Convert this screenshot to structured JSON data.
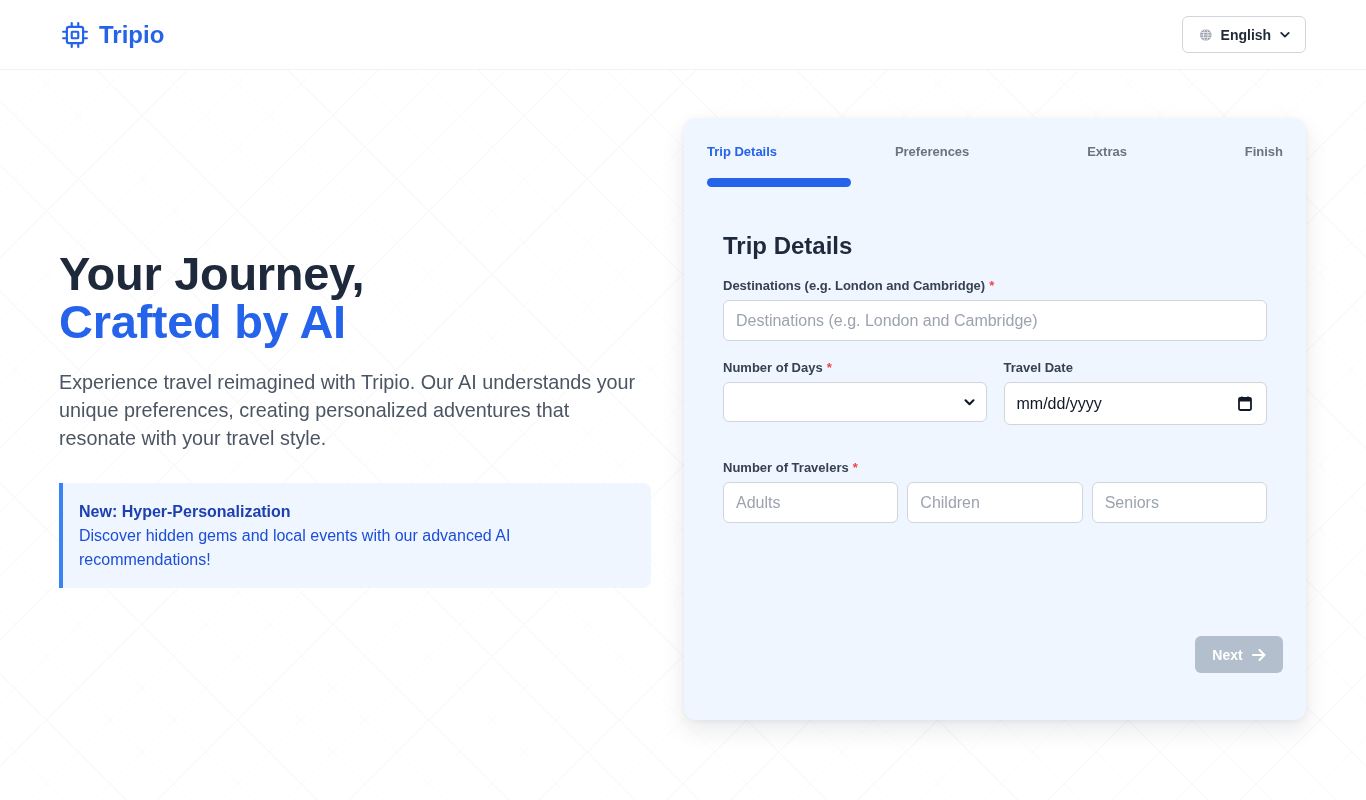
{
  "header": {
    "logo": {
      "text": "Tripio"
    },
    "language_button": {
      "label": "English"
    }
  },
  "hero": {
    "title_line_1": "Your Journey,",
    "title_line_2": "Crafted by AI",
    "description": "Experience travel reimagined with Tripio. Our AI understands your unique preferences, creating personalized adventures that resonate with your travel style.",
    "callout": {
      "title": "New: Hyper-Personalization",
      "text": "Discover hidden gems and local events with our advanced AI recommendations!"
    }
  },
  "wizard": {
    "steps": [
      {
        "label": "Trip Details",
        "selected": true
      },
      {
        "label": "Preferences",
        "selected": false
      },
      {
        "label": "Extras",
        "selected": false
      },
      {
        "label": "Finish",
        "selected": false
      }
    ],
    "form": {
      "title": "Trip Details",
      "rows": [
        [
          {
            "kind": "text",
            "label": "Destinations (e.g. London and Cambridge)",
            "required_mark": "*",
            "placeholder": "Destinations (e.g. London and Cambridge)"
          }
        ],
        [
          {
            "kind": "select",
            "label": "Number of Days",
            "required_mark": "*"
          },
          {
            "kind": "date",
            "label": "Travel Date",
            "placeholder": "mm/dd/yyyy"
          }
        ],
        [
          {
            "kind": "number_group",
            "label": "Number of Travelers",
            "required_mark": "*",
            "inputs": [
              {
                "placeholder": "Adults"
              },
              {
                "placeholder": "Children"
              },
              {
                "placeholder": "Seniors"
              }
            ]
          }
        ]
      ]
    },
    "next_button": {
      "label": "Next",
      "disabled": true
    }
  }
}
